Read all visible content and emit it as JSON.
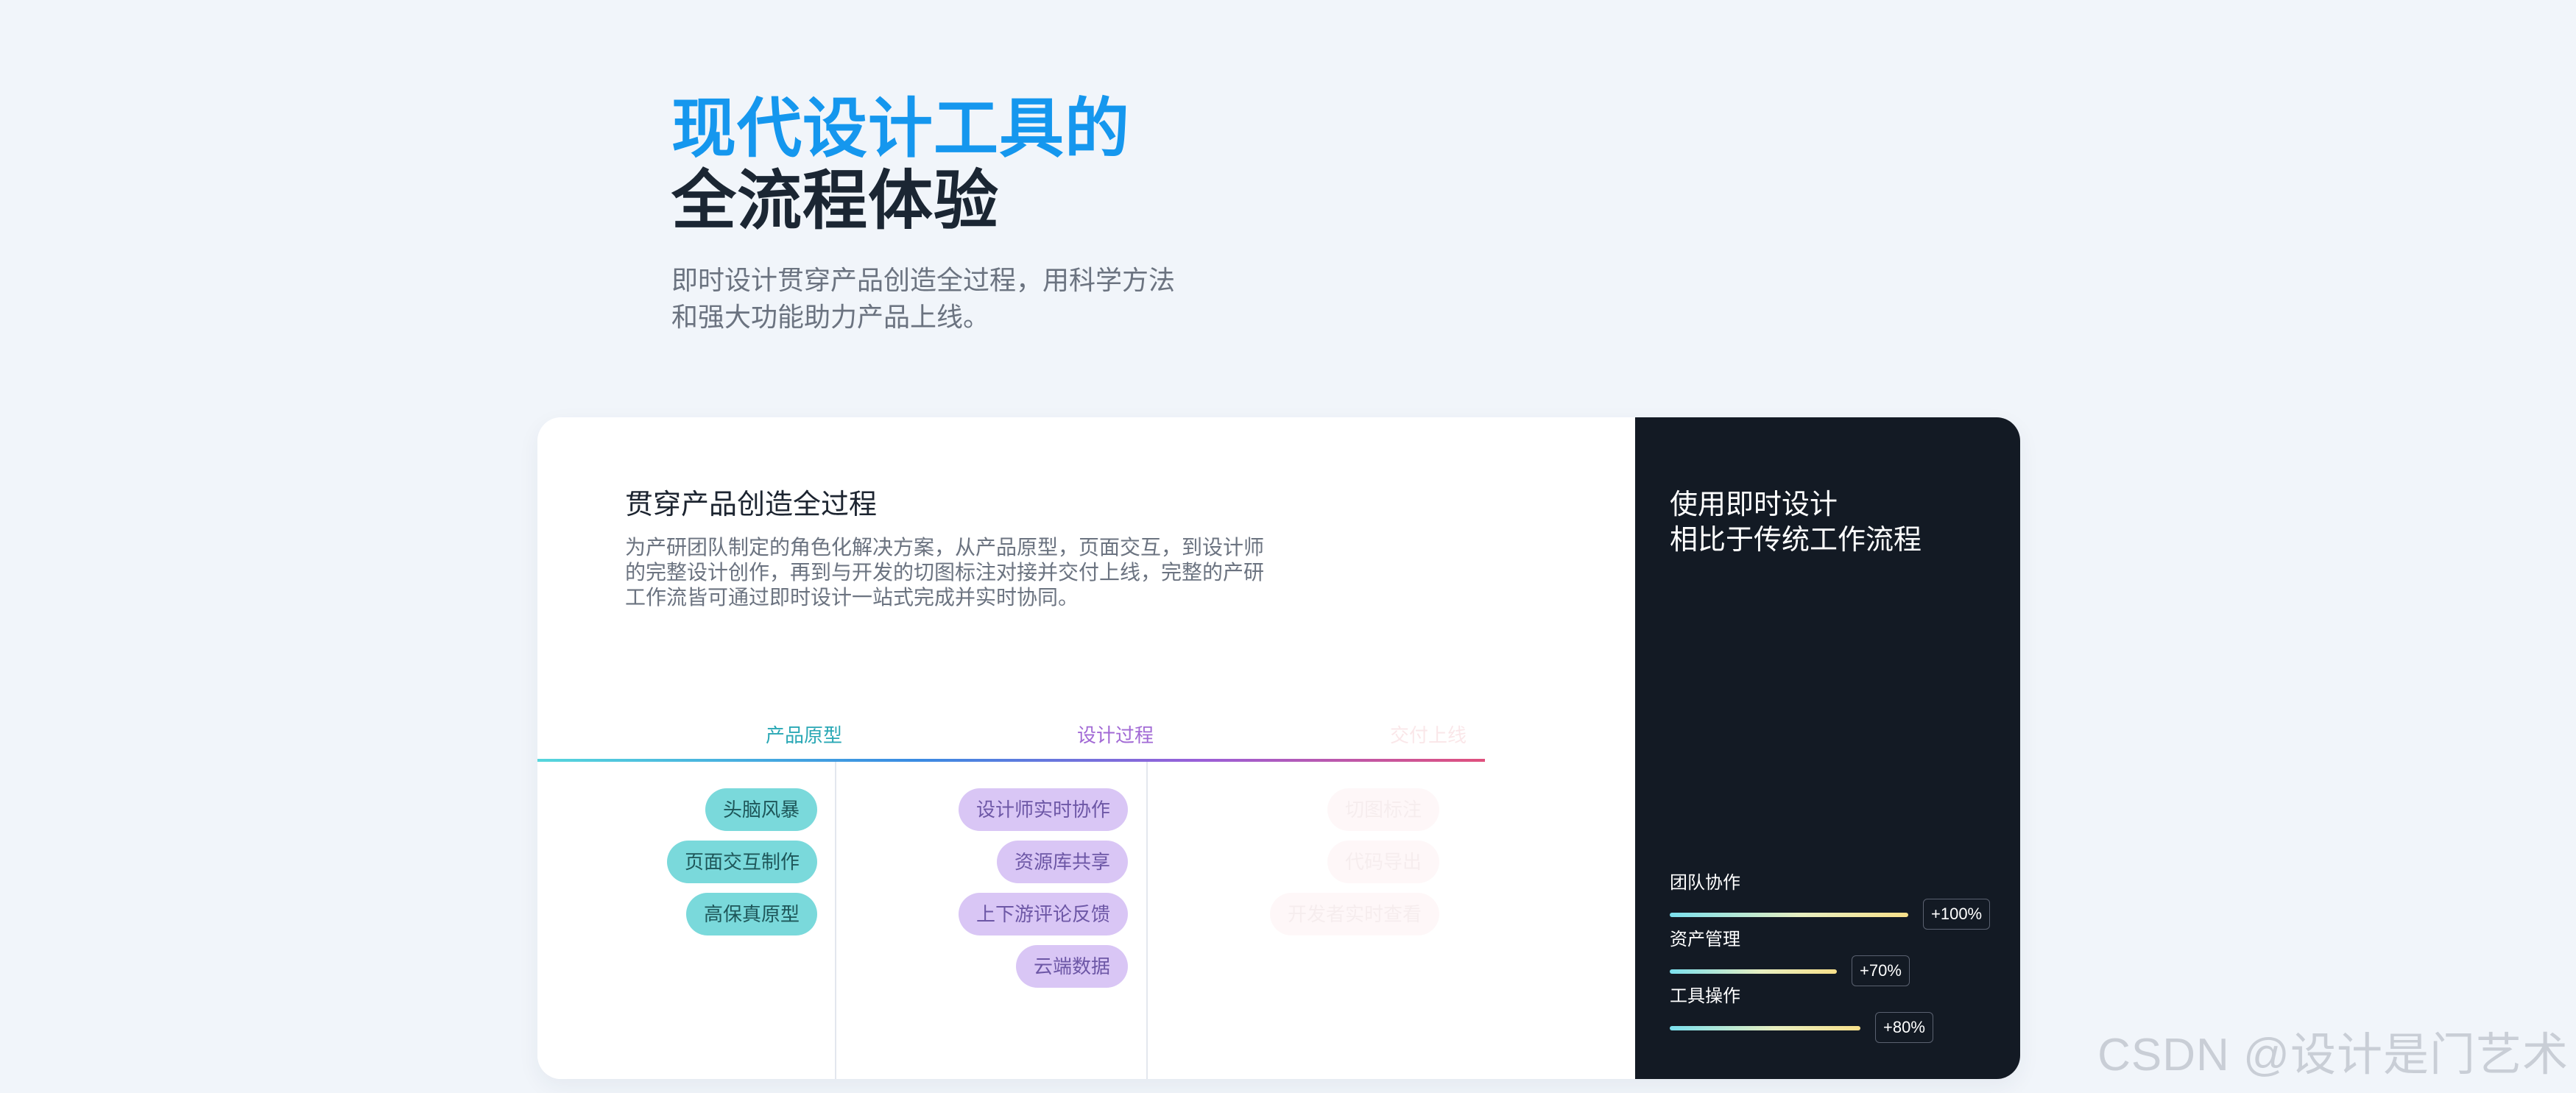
{
  "hero": {
    "title_line1": "现代设计工具的",
    "title_line2": "全流程体验",
    "subtitle": "即时设计贯穿产品创造全过程，用科学方法和强大功能助力产品上线。"
  },
  "card": {
    "left": {
      "title": "贯穿产品创造全过程",
      "description": "为产研团队制定的角色化解决方案，从产品原型，页面交互，到设计师的完整设计创作，再到与开发的切图标注对接并交付上线，完整的产研工作流皆可通过即时设计一站式完成并实时协同。",
      "phases": [
        {
          "label": "产品原型",
          "color": "#2aa8b5",
          "tags": [
            "头脑风暴",
            "页面交互制作",
            "高保真原型"
          ]
        },
        {
          "label": "设计过程",
          "color": "#a26ad5",
          "tags": [
            "设计师实时协作",
            "资源库共享",
            "上下游评论反馈",
            "云端数据"
          ]
        },
        {
          "label": "交付上线",
          "color": "#e66e7c",
          "tags": [
            "切图标注",
            "代码导出",
            "开发者实时查看"
          ]
        }
      ]
    },
    "right": {
      "title_line1": "使用即时设计",
      "title_line2": "相比于传统工作流程",
      "metrics": [
        {
          "label": "团队协作",
          "value": "+100%",
          "level": 1.0
        },
        {
          "label": "资产管理",
          "value": "+70%",
          "level": 0.7
        },
        {
          "label": "工具操作",
          "value": "+80%",
          "level": 0.8
        }
      ]
    }
  },
  "watermark": "CSDN @设计是门艺术",
  "colors": {
    "page_background": "#f1f5fa",
    "brand_blue": "#1597ee",
    "dark_panel": "#131a24",
    "teal_tag": "#7ad9db",
    "purple_tag": "#d9c6f5"
  }
}
